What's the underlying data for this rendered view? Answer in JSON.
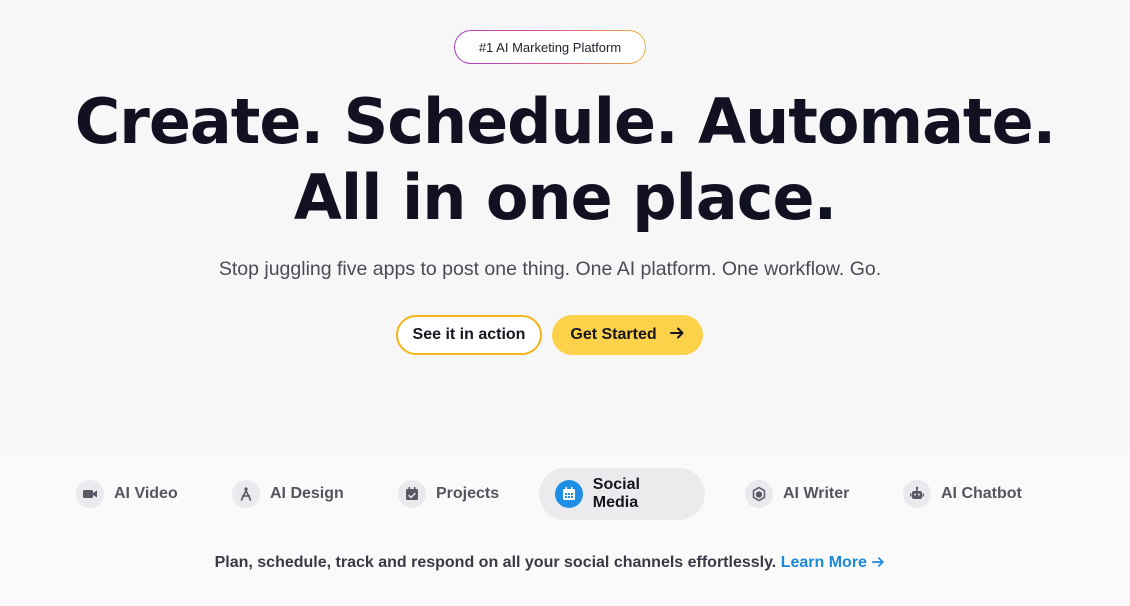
{
  "badge": {
    "text": "#1 AI Marketing Platform"
  },
  "hero": {
    "headline_line1": "Create. Schedule. Automate.",
    "headline_line2": "All in one place.",
    "subhead": "Stop juggling five apps to post one thing. One AI platform. One workflow. Go."
  },
  "buttons": {
    "secondary": "See it in action",
    "primary": "Get Started",
    "primary_icon": "arrow-right-icon"
  },
  "tabs": [
    {
      "label": "AI Video",
      "icon": "video-camera-icon",
      "active": false
    },
    {
      "label": "AI Design",
      "icon": "drawing-compass-icon",
      "active": false
    },
    {
      "label": "Projects",
      "icon": "calendar-check-icon",
      "active": false
    },
    {
      "label": "Social Media",
      "icon": "calendar-grid-icon",
      "active": true
    },
    {
      "label": "AI Writer",
      "icon": "hexagon-icon",
      "active": false
    },
    {
      "label": "AI Chatbot",
      "icon": "robot-icon",
      "active": false
    }
  ],
  "tagline": {
    "text": "Plan, schedule, track and respond on all your social channels effortlessly.",
    "link": "Learn More"
  },
  "colors": {
    "accent_yellow": "#fcd24a",
    "outline_yellow": "#f2b51a",
    "link_blue": "#1b8ad6",
    "active_icon_blue": "#1f8fe6"
  }
}
